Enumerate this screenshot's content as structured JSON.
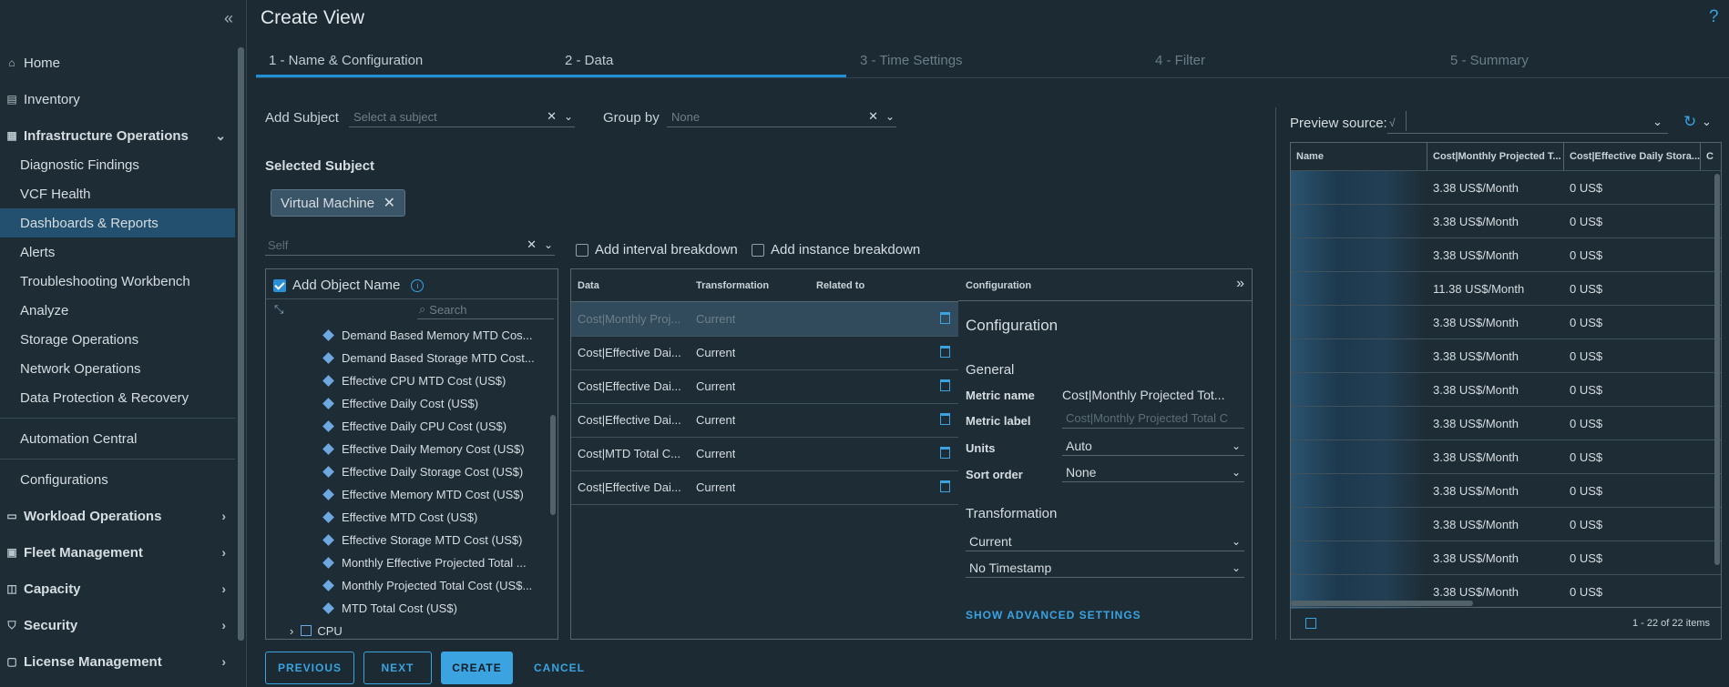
{
  "header": {
    "title": "Create View",
    "help": "?"
  },
  "sidebar": {
    "collapse": "«",
    "items": [
      {
        "label": "Home",
        "icon": "home-icon"
      },
      {
        "label": "Inventory",
        "icon": "inventory-icon"
      },
      {
        "label": "Infrastructure Operations",
        "icon": "infra-icon"
      },
      {
        "label": "Diagnostic Findings"
      },
      {
        "label": "VCF Health"
      },
      {
        "label": "Dashboards & Reports"
      },
      {
        "label": "Alerts"
      },
      {
        "label": "Troubleshooting Workbench"
      },
      {
        "label": "Analyze"
      },
      {
        "label": "Storage Operations"
      },
      {
        "label": "Network Operations"
      },
      {
        "label": "Data Protection & Recovery"
      },
      {
        "label": "Automation Central"
      },
      {
        "label": "Configurations"
      },
      {
        "label": "Workload Operations",
        "icon": "workload-icon"
      },
      {
        "label": "Fleet Management",
        "icon": "fleet-icon"
      },
      {
        "label": "Capacity",
        "icon": "capacity-icon"
      },
      {
        "label": "Security",
        "icon": "shield-icon"
      },
      {
        "label": "License Management",
        "icon": "license-icon"
      }
    ]
  },
  "steps": [
    "1 - Name & Configuration",
    "2 - Data",
    "3 - Time Settings",
    "4 - Filter",
    "5 - Summary"
  ],
  "form": {
    "add_subject_label": "Add Subject",
    "add_subject_placeholder": "Select a subject",
    "group_by_label": "Group by",
    "group_by_placeholder": "None",
    "selected_subject_title": "Selected Subject",
    "subject_chip": "Virtual Machine",
    "self_placeholder": "Self",
    "interval_breakdown": "Add interval breakdown",
    "instance_breakdown": "Add instance breakdown"
  },
  "tree": {
    "add_object_name": "Add Object Name",
    "search_placeholder": "Search",
    "items": [
      "Demand Based Memory MTD Cos...",
      "Demand Based Storage MTD Cost...",
      "Effective CPU MTD Cost (US$)",
      "Effective Daily Cost (US$)",
      "Effective Daily CPU Cost (US$)",
      "Effective Daily Memory Cost (US$)",
      "Effective Daily Storage Cost (US$)",
      "Effective Memory MTD Cost (US$)",
      "Effective MTD Cost (US$)",
      "Effective Storage MTD Cost (US$)",
      "Monthly Effective Projected Total ...",
      "Monthly Projected Total Cost (US$...",
      "MTD Total Cost (US$)"
    ],
    "folder": "CPU"
  },
  "data_grid": {
    "headers": [
      "Data",
      "Transformation",
      "Related to"
    ],
    "rows": [
      {
        "data": "Cost|Monthly Proj...",
        "transformation": "Current"
      },
      {
        "data": "Cost|Effective Dai...",
        "transformation": "Current"
      },
      {
        "data": "Cost|Effective Dai...",
        "transformation": "Current"
      },
      {
        "data": "Cost|Effective Dai...",
        "transformation": "Current"
      },
      {
        "data": "Cost|MTD Total C...",
        "transformation": "Current"
      },
      {
        "data": "Cost|Effective Dai...",
        "transformation": "Current"
      }
    ]
  },
  "config": {
    "header": "Configuration",
    "title": "Configuration",
    "general": "General",
    "metric_name_label": "Metric name",
    "metric_name_value": "Cost|Monthly Projected Tot...",
    "metric_label_label": "Metric label",
    "metric_label_placeholder": "Cost|Monthly Projected Total C",
    "units_label": "Units",
    "units_value": "Auto",
    "sort_label": "Sort order",
    "sort_value": "None",
    "transformation_title": "Transformation",
    "transformation_value": "Current",
    "timestamp_value": "No Timestamp",
    "advanced": "SHOW ADVANCED SETTINGS"
  },
  "preview": {
    "source_label": "Preview source:",
    "source_glyph": "√",
    "headers": [
      "Name",
      "Cost|Monthly Projected T...",
      "Cost|Effective Daily Stora...",
      "C"
    ],
    "rows": [
      [
        "3.38 US$/Month",
        "0 US$"
      ],
      [
        "3.38 US$/Month",
        "0 US$"
      ],
      [
        "3.38 US$/Month",
        "0 US$"
      ],
      [
        "11.38 US$/Month",
        "0 US$"
      ],
      [
        "3.38 US$/Month",
        "0 US$"
      ],
      [
        "3.38 US$/Month",
        "0 US$"
      ],
      [
        "3.38 US$/Month",
        "0 US$"
      ],
      [
        "3.38 US$/Month",
        "0 US$"
      ],
      [
        "3.38 US$/Month",
        "0 US$"
      ],
      [
        "3.38 US$/Month",
        "0 US$"
      ],
      [
        "3.38 US$/Month",
        "0 US$"
      ],
      [
        "3.38 US$/Month",
        "0 US$"
      ],
      [
        "3.38 US$/Month",
        "0 US$"
      ]
    ],
    "footer": "1 - 22 of 22 items"
  },
  "buttons": {
    "previous": "PREVIOUS",
    "next": "NEXT",
    "create": "CREATE",
    "cancel": "CANCEL"
  },
  "colors": {
    "accent": "#3aa3e0",
    "active_nav": "#23506e",
    "background": "#1b2a33"
  }
}
